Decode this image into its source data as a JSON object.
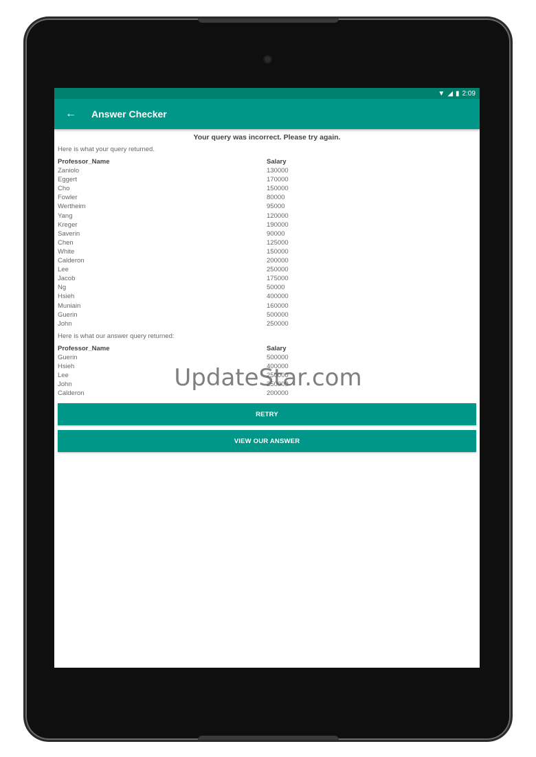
{
  "status_bar": {
    "time": "2:09",
    "wifi_icon": "wifi-icon",
    "signal_icon": "signal-icon",
    "battery_icon": "battery-icon"
  },
  "app_bar": {
    "title": "Answer Checker",
    "back_icon": "arrow-left-icon"
  },
  "message": "Your query was incorrect. Please try again.",
  "your_result": {
    "label": "Here is what your query returned.",
    "columns": [
      "Professor_Name",
      "Salary"
    ],
    "rows": [
      [
        "Zaniolo",
        "130000"
      ],
      [
        "Eggert",
        "170000"
      ],
      [
        "Cho",
        "150000"
      ],
      [
        "Fowler",
        "80000"
      ],
      [
        "Wertheim",
        "95000"
      ],
      [
        "Yang",
        "120000"
      ],
      [
        "Kreger",
        "190000"
      ],
      [
        "Saverin",
        "90000"
      ],
      [
        "Chen",
        "125000"
      ],
      [
        "White",
        "150000"
      ],
      [
        "Calderon",
        "200000"
      ],
      [
        "Lee",
        "250000"
      ],
      [
        "Jacob",
        "175000"
      ],
      [
        "Ng",
        "50000"
      ],
      [
        "Hsieh",
        "400000"
      ],
      [
        "Muniain",
        "160000"
      ],
      [
        "Guerin",
        "500000"
      ],
      [
        "John",
        "250000"
      ]
    ]
  },
  "our_result": {
    "label": "Here is what our answer query returned:",
    "columns": [
      "Professor_Name",
      "Salary"
    ],
    "rows": [
      [
        "Guerin",
        "500000"
      ],
      [
        "Hsieh",
        "400000"
      ],
      [
        "Lee",
        "250000"
      ],
      [
        "John",
        "250000"
      ],
      [
        "Calderon",
        "200000"
      ]
    ]
  },
  "buttons": {
    "retry": "RETRY",
    "view_answer": "VIEW OUR ANSWER"
  },
  "watermark": "UpdateStar.com",
  "colors": {
    "accent": "#009688",
    "status_bar": "#00806f"
  }
}
